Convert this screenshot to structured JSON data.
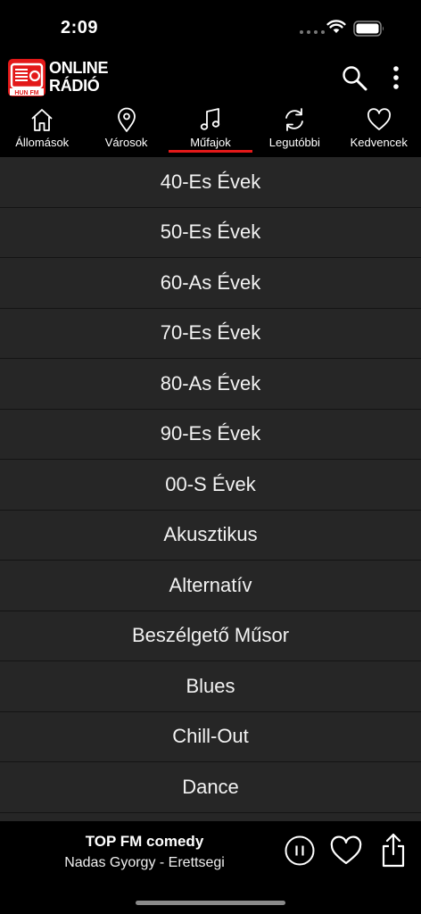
{
  "status_bar": {
    "time": "2:09"
  },
  "header": {
    "logo_badge": "HUN FM",
    "logo_line1": "ONLINE",
    "logo_line2": "RÁDIÓ"
  },
  "tabs": [
    {
      "label": "Állomások",
      "icon": "home-icon"
    },
    {
      "label": "Városok",
      "icon": "map-pin-icon"
    },
    {
      "label": "Műfajok",
      "icon": "music-note-icon",
      "active": true
    },
    {
      "label": "Legutóbbi",
      "icon": "refresh-icon"
    },
    {
      "label": "Kedvencek",
      "icon": "heart-icon"
    }
  ],
  "genres": [
    "40-Es Évek",
    "50-Es Évek",
    "60-As Évek",
    "70-Es Évek",
    "80-As Évek",
    "90-Es Évek",
    "00-S Évek",
    "Akusztikus",
    "Alternatív",
    "Beszélgető Műsor",
    "Blues",
    "Chill-Out",
    "Dance"
  ],
  "player": {
    "title": "TOP FM comedy",
    "subtitle": "Nadas Gyorgy - Erettsegi"
  },
  "colors": {
    "accent": "#e31919",
    "list_bg": "#262626"
  }
}
